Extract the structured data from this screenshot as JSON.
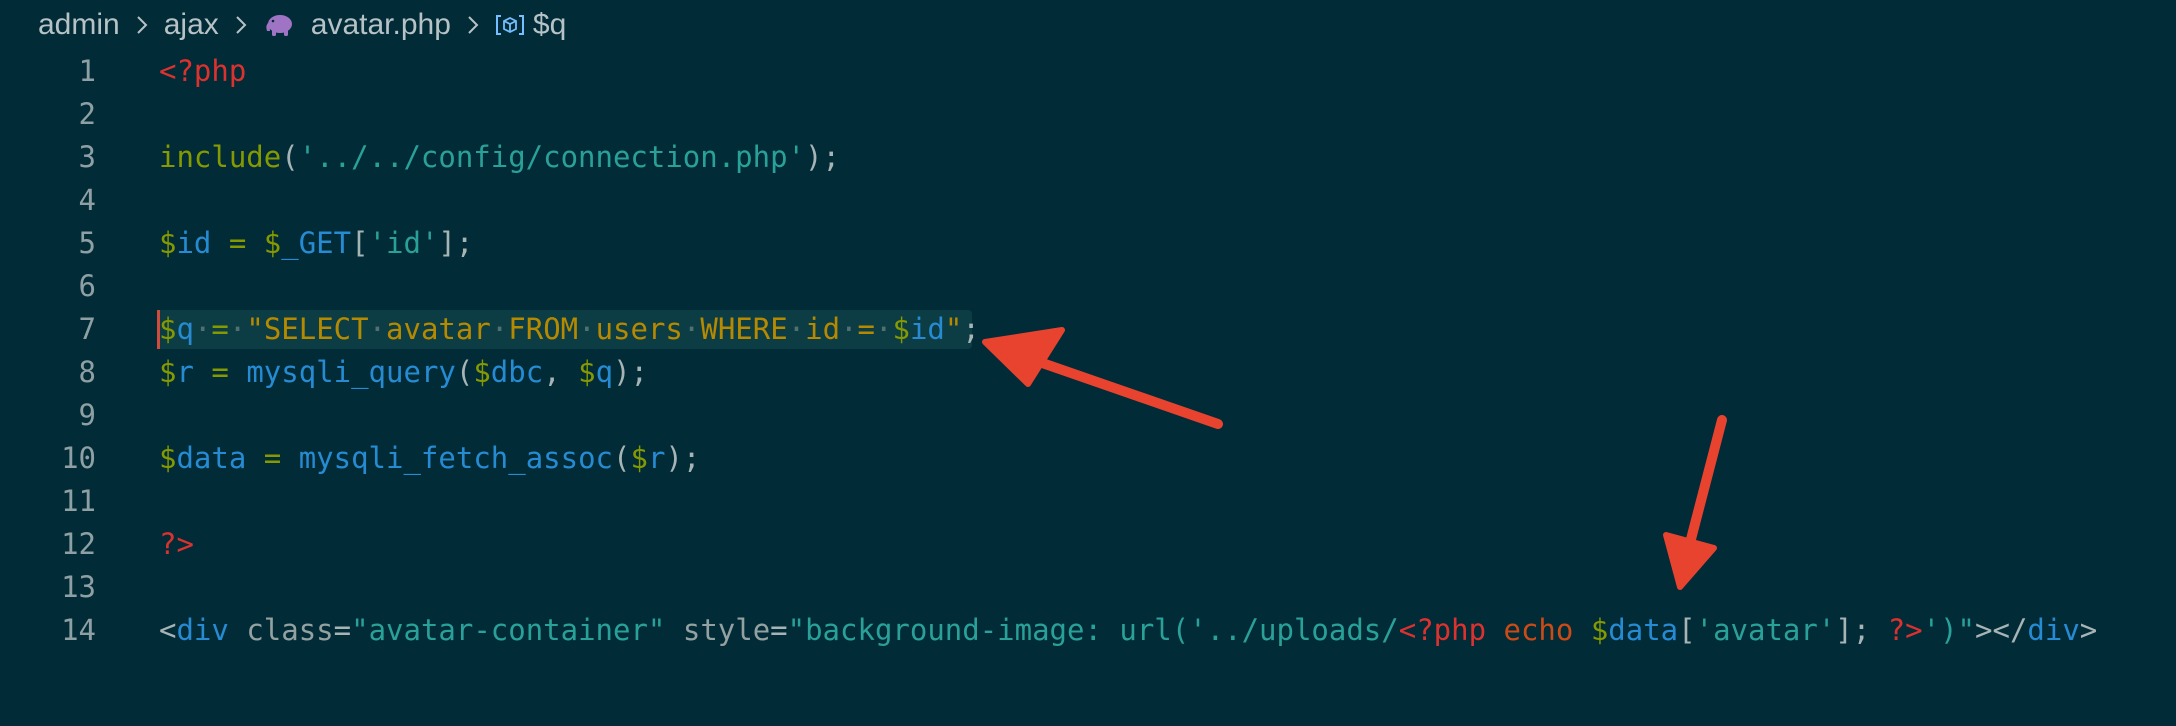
{
  "breadcrumb": {
    "items": [
      "admin",
      "ajax",
      "avatar.php",
      "$q"
    ]
  },
  "icons": {
    "separator": "chevron-right-icon",
    "file": "php-elephant-icon",
    "symbol": "variable-icon"
  },
  "colors": {
    "background": "#012b36",
    "annotation_arrow": "#e8432f",
    "line_highlight": "#0d3d44"
  },
  "editor": {
    "highlighted_line": 7,
    "lines": [
      {
        "number": "1",
        "text": "<?php"
      },
      {
        "number": "2",
        "text": ""
      },
      {
        "number": "3",
        "text": "include('../../config/connection.php');"
      },
      {
        "number": "4",
        "text": ""
      },
      {
        "number": "5",
        "text": "$id = $_GET['id'];"
      },
      {
        "number": "6",
        "text": ""
      },
      {
        "number": "7",
        "text": "$q = \"SELECT avatar FROM users WHERE id = $id\";"
      },
      {
        "number": "8",
        "text": "$r = mysqli_query($dbc, $q);"
      },
      {
        "number": "9",
        "text": ""
      },
      {
        "number": "10",
        "text": "$data = mysqli_fetch_assoc($r);"
      },
      {
        "number": "11",
        "text": ""
      },
      {
        "number": "12",
        "text": "?>"
      },
      {
        "number": "13",
        "text": ""
      },
      {
        "number": "14",
        "text": "<div class=\"avatar-container\" style=\"background-image: url('../uploads/<?php echo $data['avatar']; ?>')\"></div>"
      }
    ]
  }
}
